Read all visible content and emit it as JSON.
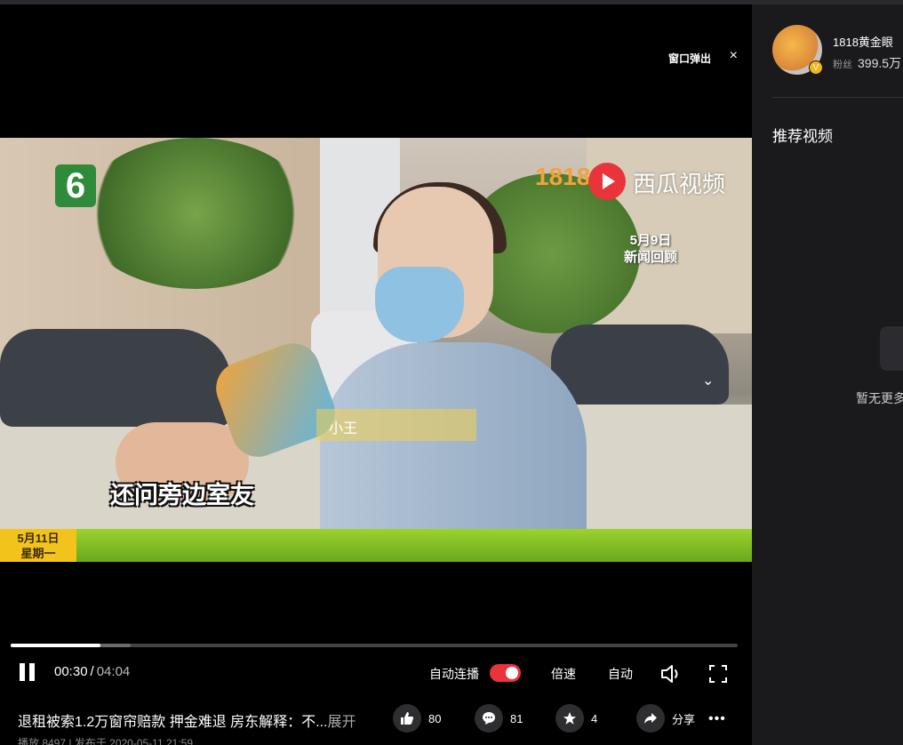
{
  "player": {
    "popout_label": "窗口弹出",
    "close_glyph": "×",
    "overlay": {
      "channel_number": "6",
      "watermark_1818": "1818",
      "watermark_brand": "西瓜视频",
      "recap_line1": "5月9日",
      "recap_line2": "新闻回顾",
      "name_tag": "小王",
      "subtitle": "还问旁边室友",
      "date_line1": "5月11日",
      "date_line2": "星期一"
    },
    "controls": {
      "current_time": "00:30",
      "separator": "/",
      "total_time": "04:04",
      "autoplay_label": "自动连播",
      "autoplay_on": true,
      "speed_label": "倍速",
      "quality_label": "自动",
      "progress_played_fraction": 0.123,
      "progress_buffered_fraction": 0.165
    }
  },
  "video": {
    "title": "退租被索1.2万窗帘赔款 押金难退 房东解释：不...",
    "expand_label": "展开",
    "meta": "播放 8497 | 发布于 2020-05-11 21:59",
    "likes": "80",
    "comments": "81",
    "favorites": "4",
    "share_label": "分享",
    "more_glyph": "•••"
  },
  "sidebar": {
    "channel_name": "1818黄金眼",
    "fans_label": "粉丝",
    "fans_count": "399.5万",
    "verified_glyph": "V",
    "recommend_title": "推荐视频",
    "empty_text": "暂无更多"
  },
  "colors": {
    "accent_red": "#e8343a",
    "sidebar_bg": "#1a1a1d",
    "banner_green": "#8bc926",
    "date_yellow": "#f2c41b"
  }
}
